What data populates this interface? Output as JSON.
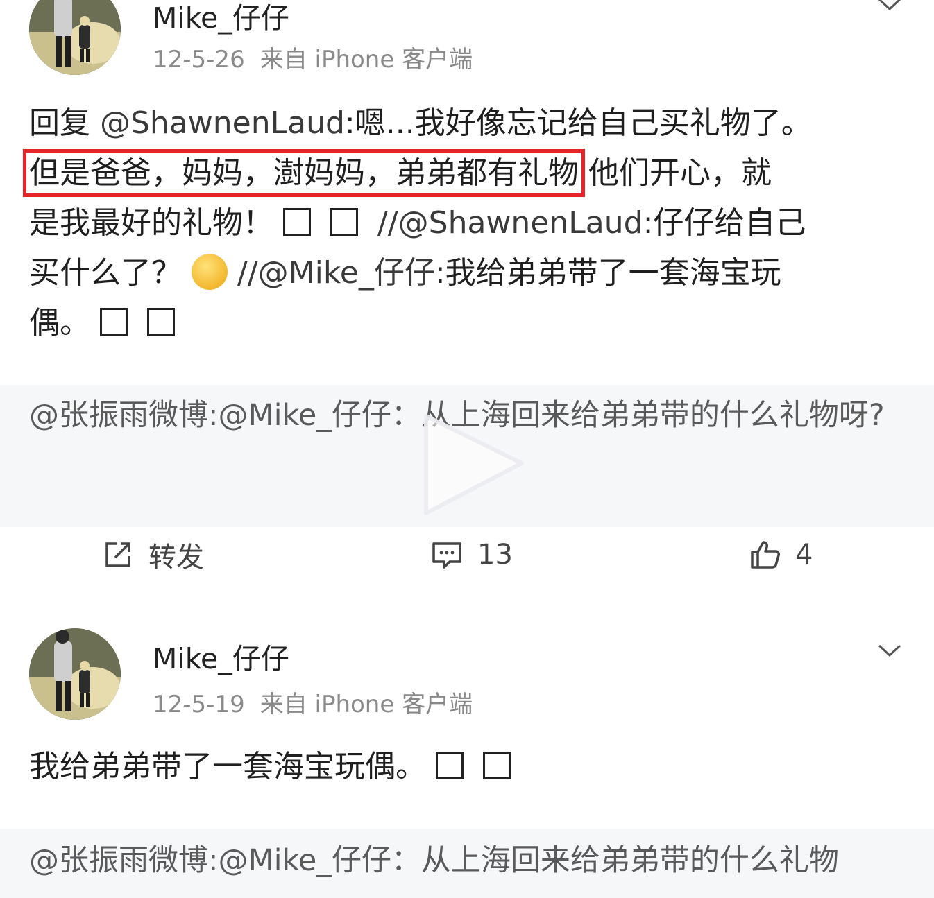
{
  "posts": [
    {
      "username": "Mike_仔仔",
      "date": "12-5-26",
      "source": "来自 iPhone 客户端",
      "lines": {
        "l1_prefix": "回复 ",
        "l1_mention": "@ShawnenLaud",
        "l1_rest": ":嗯...我好像忘记给自己买礼物了。",
        "l2_highlight": "但是爸爸，妈妈，澍妈妈，弟弟都有礼物",
        "l2_rest": " 他们开心，就",
        "l3_text": "是我最好的礼物！",
        "l3_quote_prefix": "//@ShawnenLaud",
        "l3_quote_rest": ":仔仔给自己",
        "l4_text": "买什么了？",
        "l4_quote_prefix": "//@Mike_仔仔",
        "l4_quote_rest": ":我给弟弟带了一套海宝玩",
        "l5_text": "偶。"
      },
      "quote": "@张振雨微博:@Mike_仔仔：从上海回来给弟弟带的什么礼物呀?",
      "actions": {
        "repost_label": "转发",
        "comment_count": "13",
        "like_count": "4"
      }
    },
    {
      "username": "Mike_仔仔",
      "date": "12-5-19",
      "source": "来自 iPhone 客户端",
      "text": "我给弟弟带了一套海宝玩偶。",
      "quote": "@张振雨微博:@Mike_仔仔：从上海回来给弟弟带的什么礼物"
    }
  ],
  "colors": {
    "highlight_border": "#e2262a",
    "quote_background": "#f6f7f9",
    "meta_text": "#8a8a8a"
  },
  "icons": [
    "avatar-photo",
    "chevron-down-icon",
    "emoji-icon",
    "play-icon",
    "repost-icon",
    "comment-icon",
    "like-icon"
  ]
}
